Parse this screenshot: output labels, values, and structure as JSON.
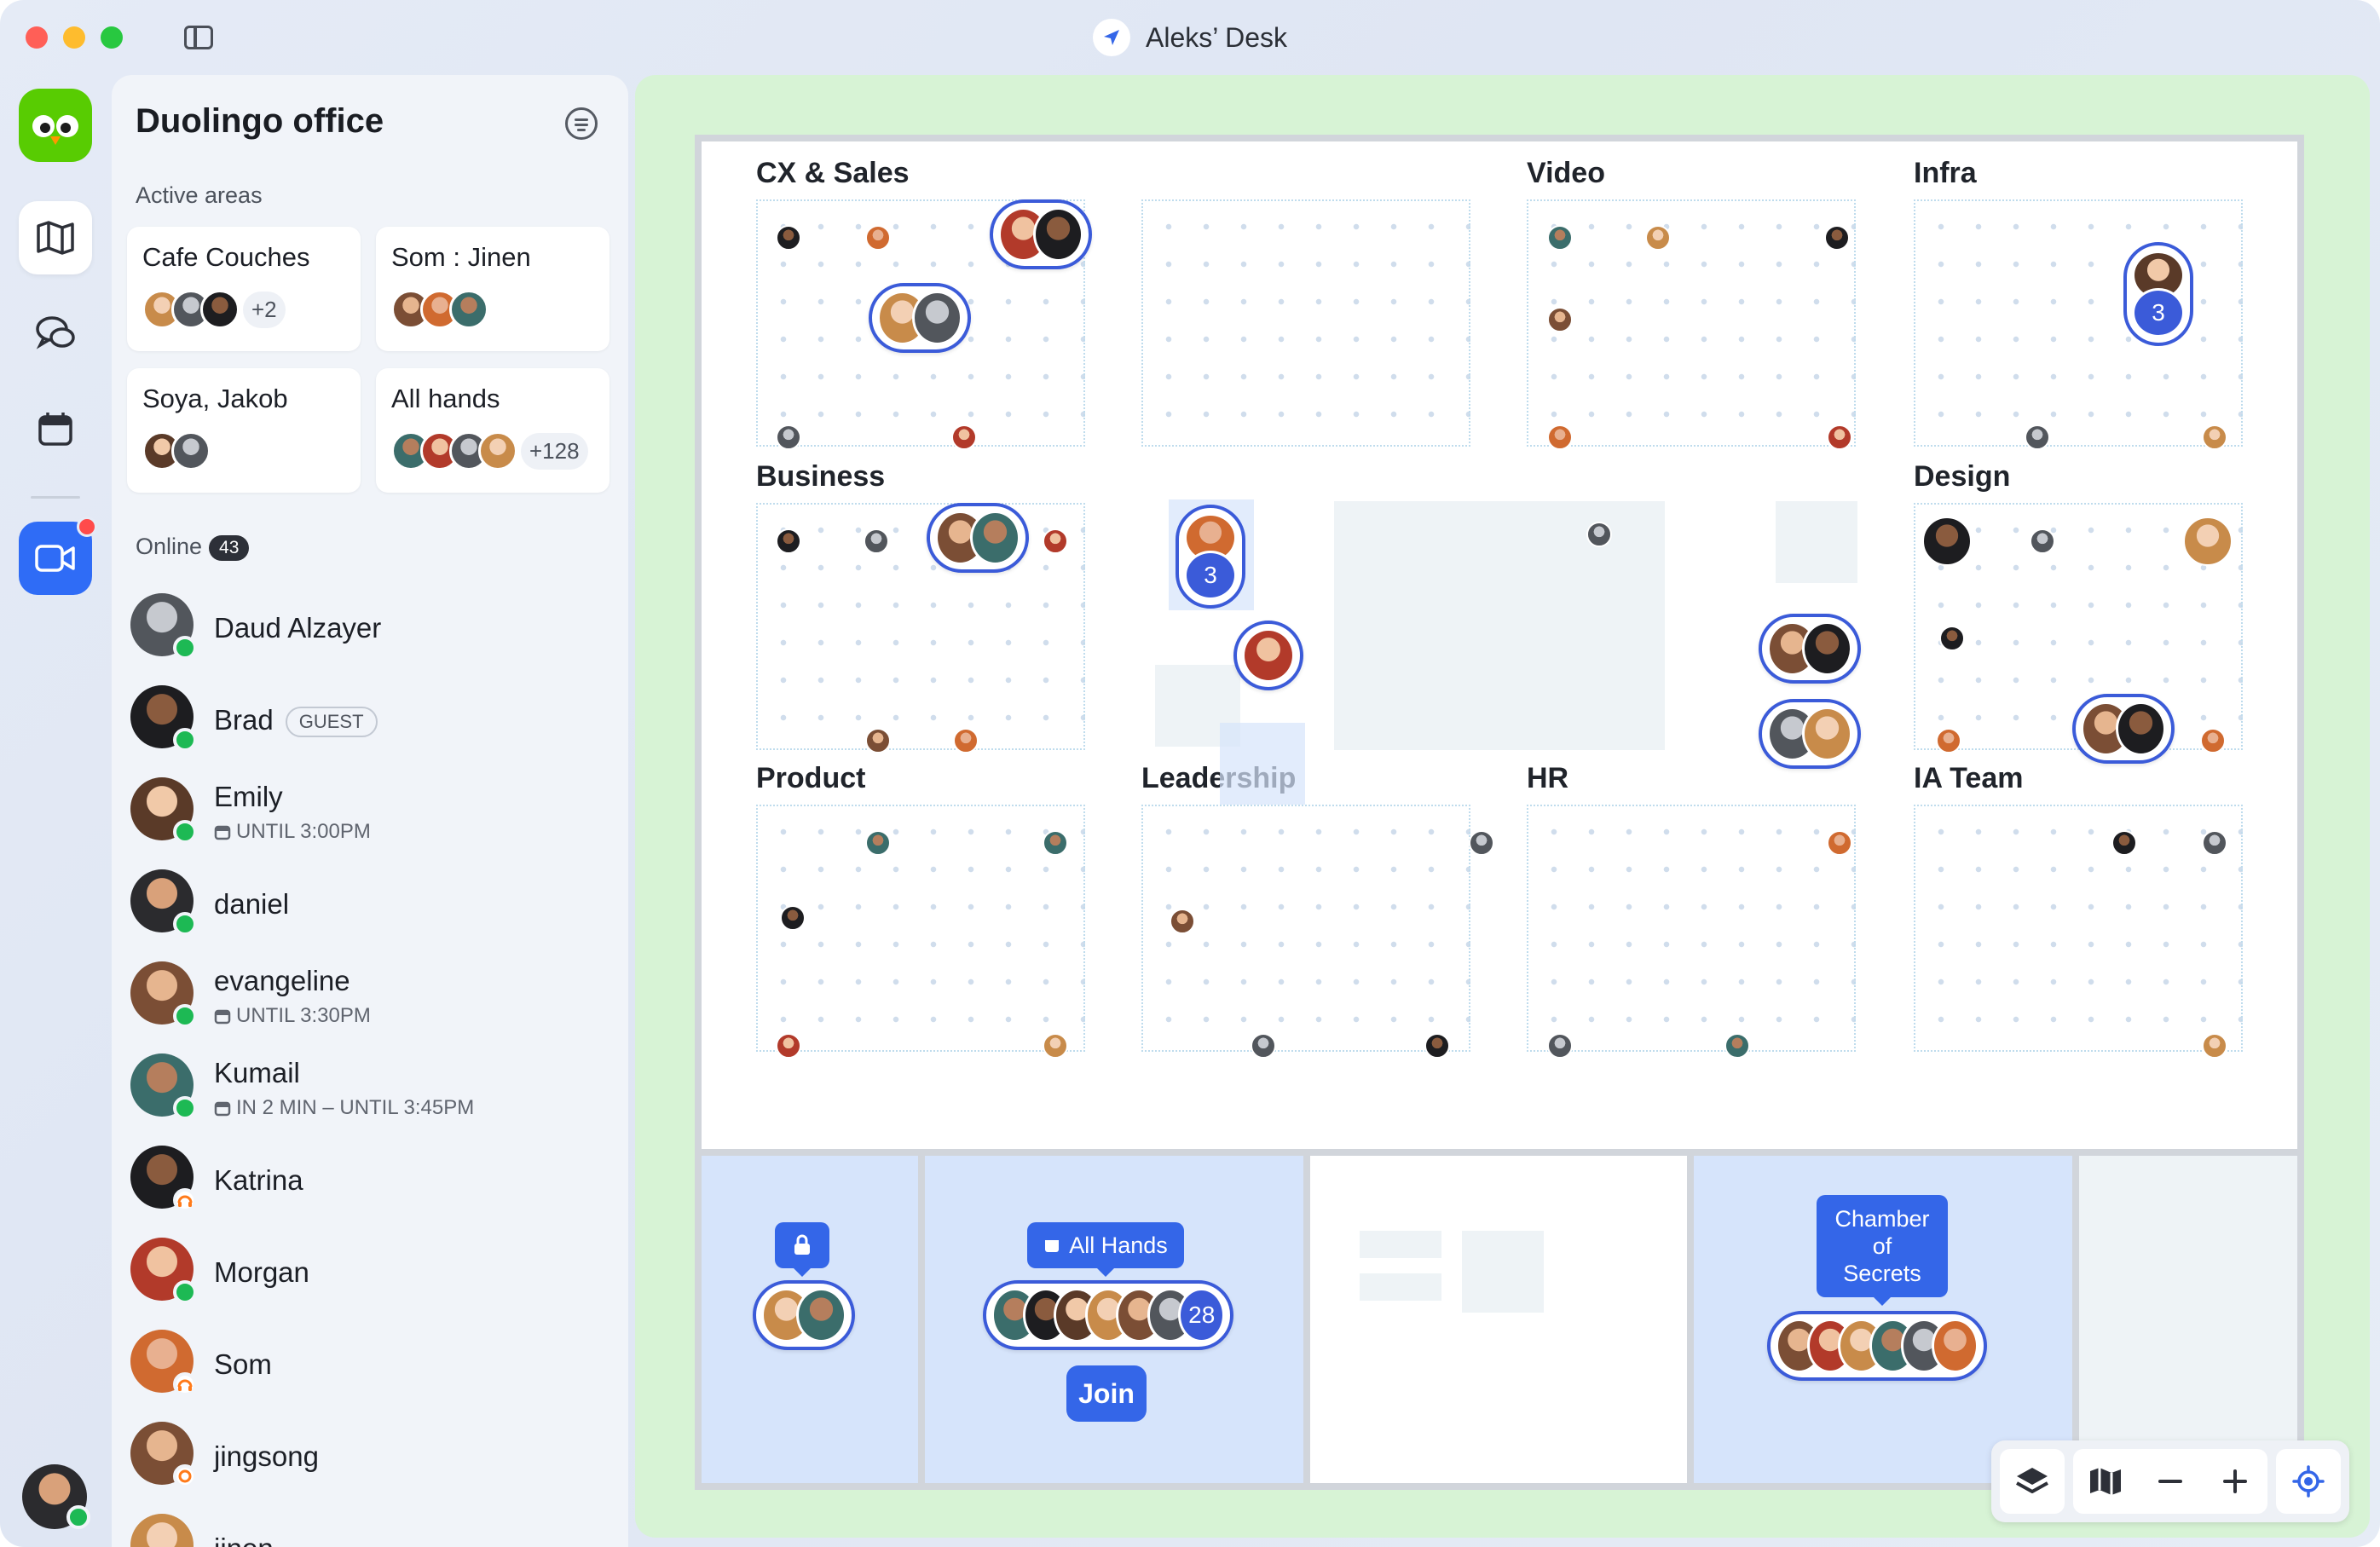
{
  "window": {
    "title": "Aleks’ Desk"
  },
  "panel": {
    "title": "Duolingo office",
    "active_label": "Active areas",
    "online_label": "Online",
    "online_count": "43",
    "areas": [
      {
        "name": "Cafe Couches",
        "more": "+2"
      },
      {
        "name": "Som : Jinen",
        "more": ""
      },
      {
        "name": "Soya, Jakob",
        "more": ""
      },
      {
        "name": "All hands",
        "more": "+128"
      }
    ],
    "people": [
      {
        "name": "Daud Alzayer",
        "sub": "",
        "status": "green"
      },
      {
        "name": "Brad",
        "badge": "GUEST",
        "sub": "",
        "status": "green"
      },
      {
        "name": "Emily",
        "sub": "UNTIL 3:00PM",
        "status": "green"
      },
      {
        "name": "daniel",
        "sub": "",
        "status": "green"
      },
      {
        "name": "evangeline",
        "sub": "UNTIL 3:30PM",
        "status": "green"
      },
      {
        "name": "Kumail",
        "sub": "IN 2 MIN – UNTIL 3:45PM",
        "status": "green"
      },
      {
        "name": "Katrina",
        "sub": "",
        "status": "orange"
      },
      {
        "name": "Morgan",
        "sub": "",
        "status": "green"
      },
      {
        "name": "Som",
        "sub": "",
        "status": "orange"
      },
      {
        "name": "jingsong",
        "sub": "",
        "status": "orange"
      },
      {
        "name": "jinen",
        "sub": "",
        "status": "green"
      }
    ]
  },
  "map": {
    "zones": [
      "CX & Sales",
      "Video",
      "Infra",
      "Business",
      "Design",
      "Product",
      "Leadership",
      "HR",
      "IA Team"
    ],
    "cluster_counts": {
      "infra": "3",
      "center": "3",
      "all_hands": "28"
    },
    "rooms": {
      "all_hands_label": "All Hands",
      "join_label": "Join",
      "chamber_label": "Chamber of Secrets"
    }
  },
  "icons": {
    "rail": [
      "map-icon",
      "chat-icon",
      "calendar-icon",
      "video-icon"
    ],
    "toolbar": [
      "layers-icon",
      "map-icon",
      "zoom-out-icon",
      "zoom-in-icon",
      "locate-icon"
    ]
  },
  "colors": {
    "accent": "#3466e8",
    "map_bg": "#d7f3d5",
    "room": "#d6e4fb",
    "online": "#1db954",
    "brand": "#58cc02"
  }
}
